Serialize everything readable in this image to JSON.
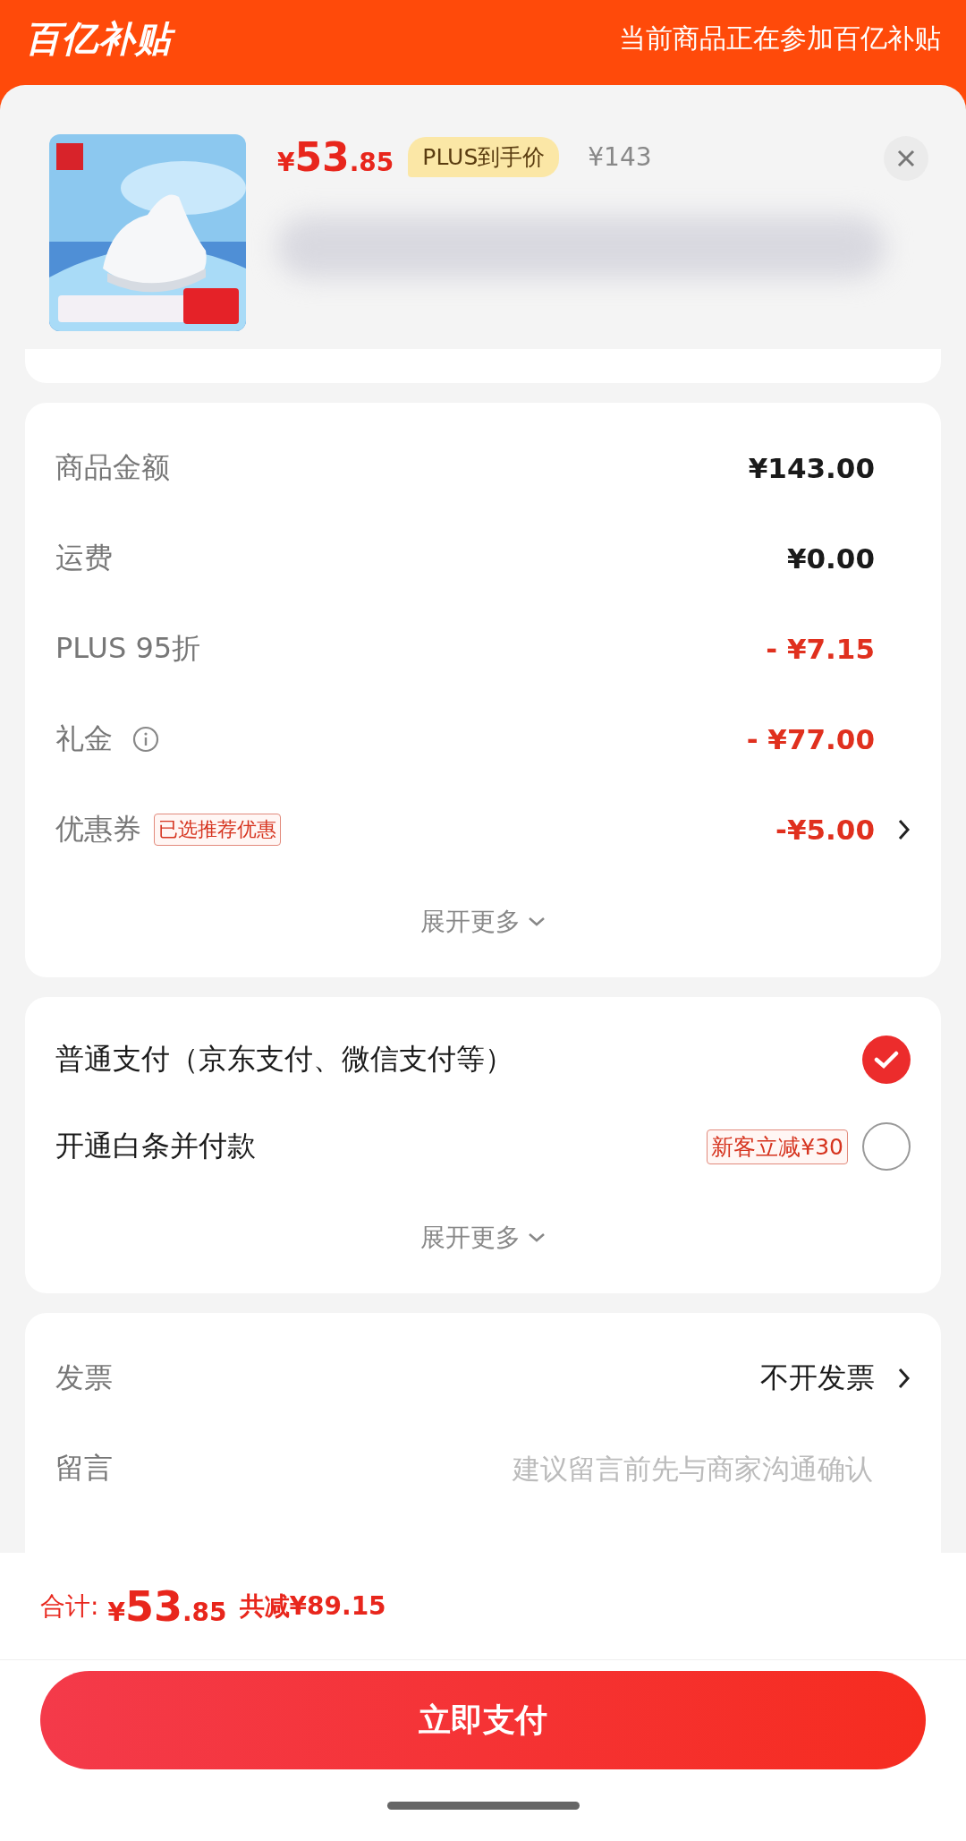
{
  "header": {
    "logo": "百亿补贴",
    "notice": "当前商品正在参加百亿补贴"
  },
  "product": {
    "price_symbol": "¥",
    "price_int": "53",
    "price_dec": ".85",
    "price_tag": "PLUS到手价",
    "original_price": "¥143"
  },
  "fees": [
    {
      "label": "商品金额",
      "value": "¥143.00",
      "kind": "plain"
    },
    {
      "label": "运费",
      "value": "¥0.00",
      "kind": "plain"
    },
    {
      "label": "PLUS 95折",
      "value": "- ¥7.15",
      "kind": "discount"
    },
    {
      "label": "礼金",
      "value": "- ¥77.00",
      "kind": "discount",
      "info": true
    },
    {
      "label": "优惠券",
      "tag": "已选推荐优惠",
      "value": "-¥5.00",
      "kind": "discount",
      "arrow": true
    }
  ],
  "fees_more": "展开更多",
  "payments": [
    {
      "label": "普通支付（京东支付、微信支付等）",
      "selected": true
    },
    {
      "label": "开通白条并付款",
      "promo": "新客立减¥30",
      "selected": false
    }
  ],
  "payments_more": "展开更多",
  "extras": [
    {
      "label": "发票",
      "value": "不开发票",
      "arrow": true
    },
    {
      "label": "留言",
      "placeholder": "建议留言前先与商家沟通确认"
    }
  ],
  "footer": {
    "total_label": "合计:",
    "total_symbol": "¥",
    "total_int": "53",
    "total_dec": ".85",
    "saved": "共减¥89.15",
    "pay_button": "立即支付"
  }
}
